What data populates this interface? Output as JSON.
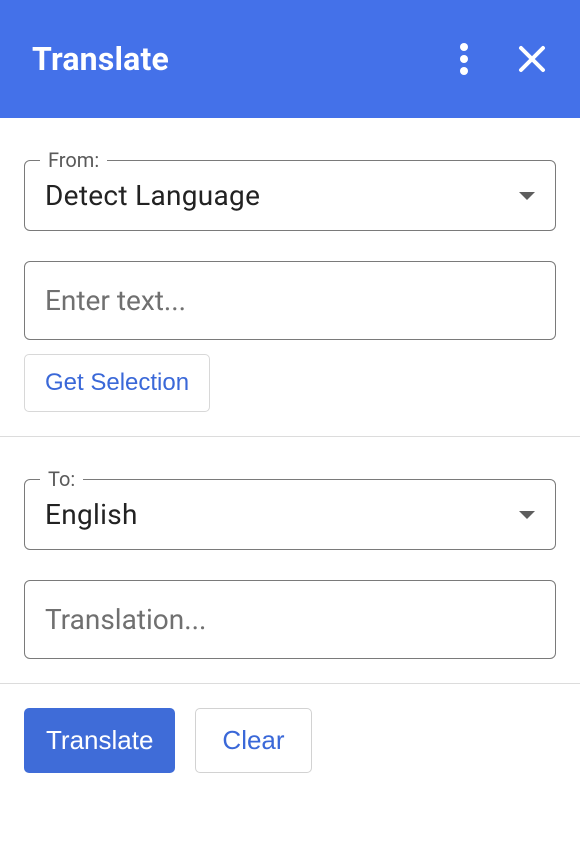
{
  "header": {
    "title": "Translate"
  },
  "from": {
    "label": "From:",
    "value": "Detect Language"
  },
  "input": {
    "placeholder": "Enter text..."
  },
  "get_selection_label": "Get Selection",
  "to": {
    "label": "To:",
    "value": "English"
  },
  "output": {
    "placeholder": "Translation..."
  },
  "actions": {
    "translate": "Translate",
    "clear": "Clear"
  }
}
